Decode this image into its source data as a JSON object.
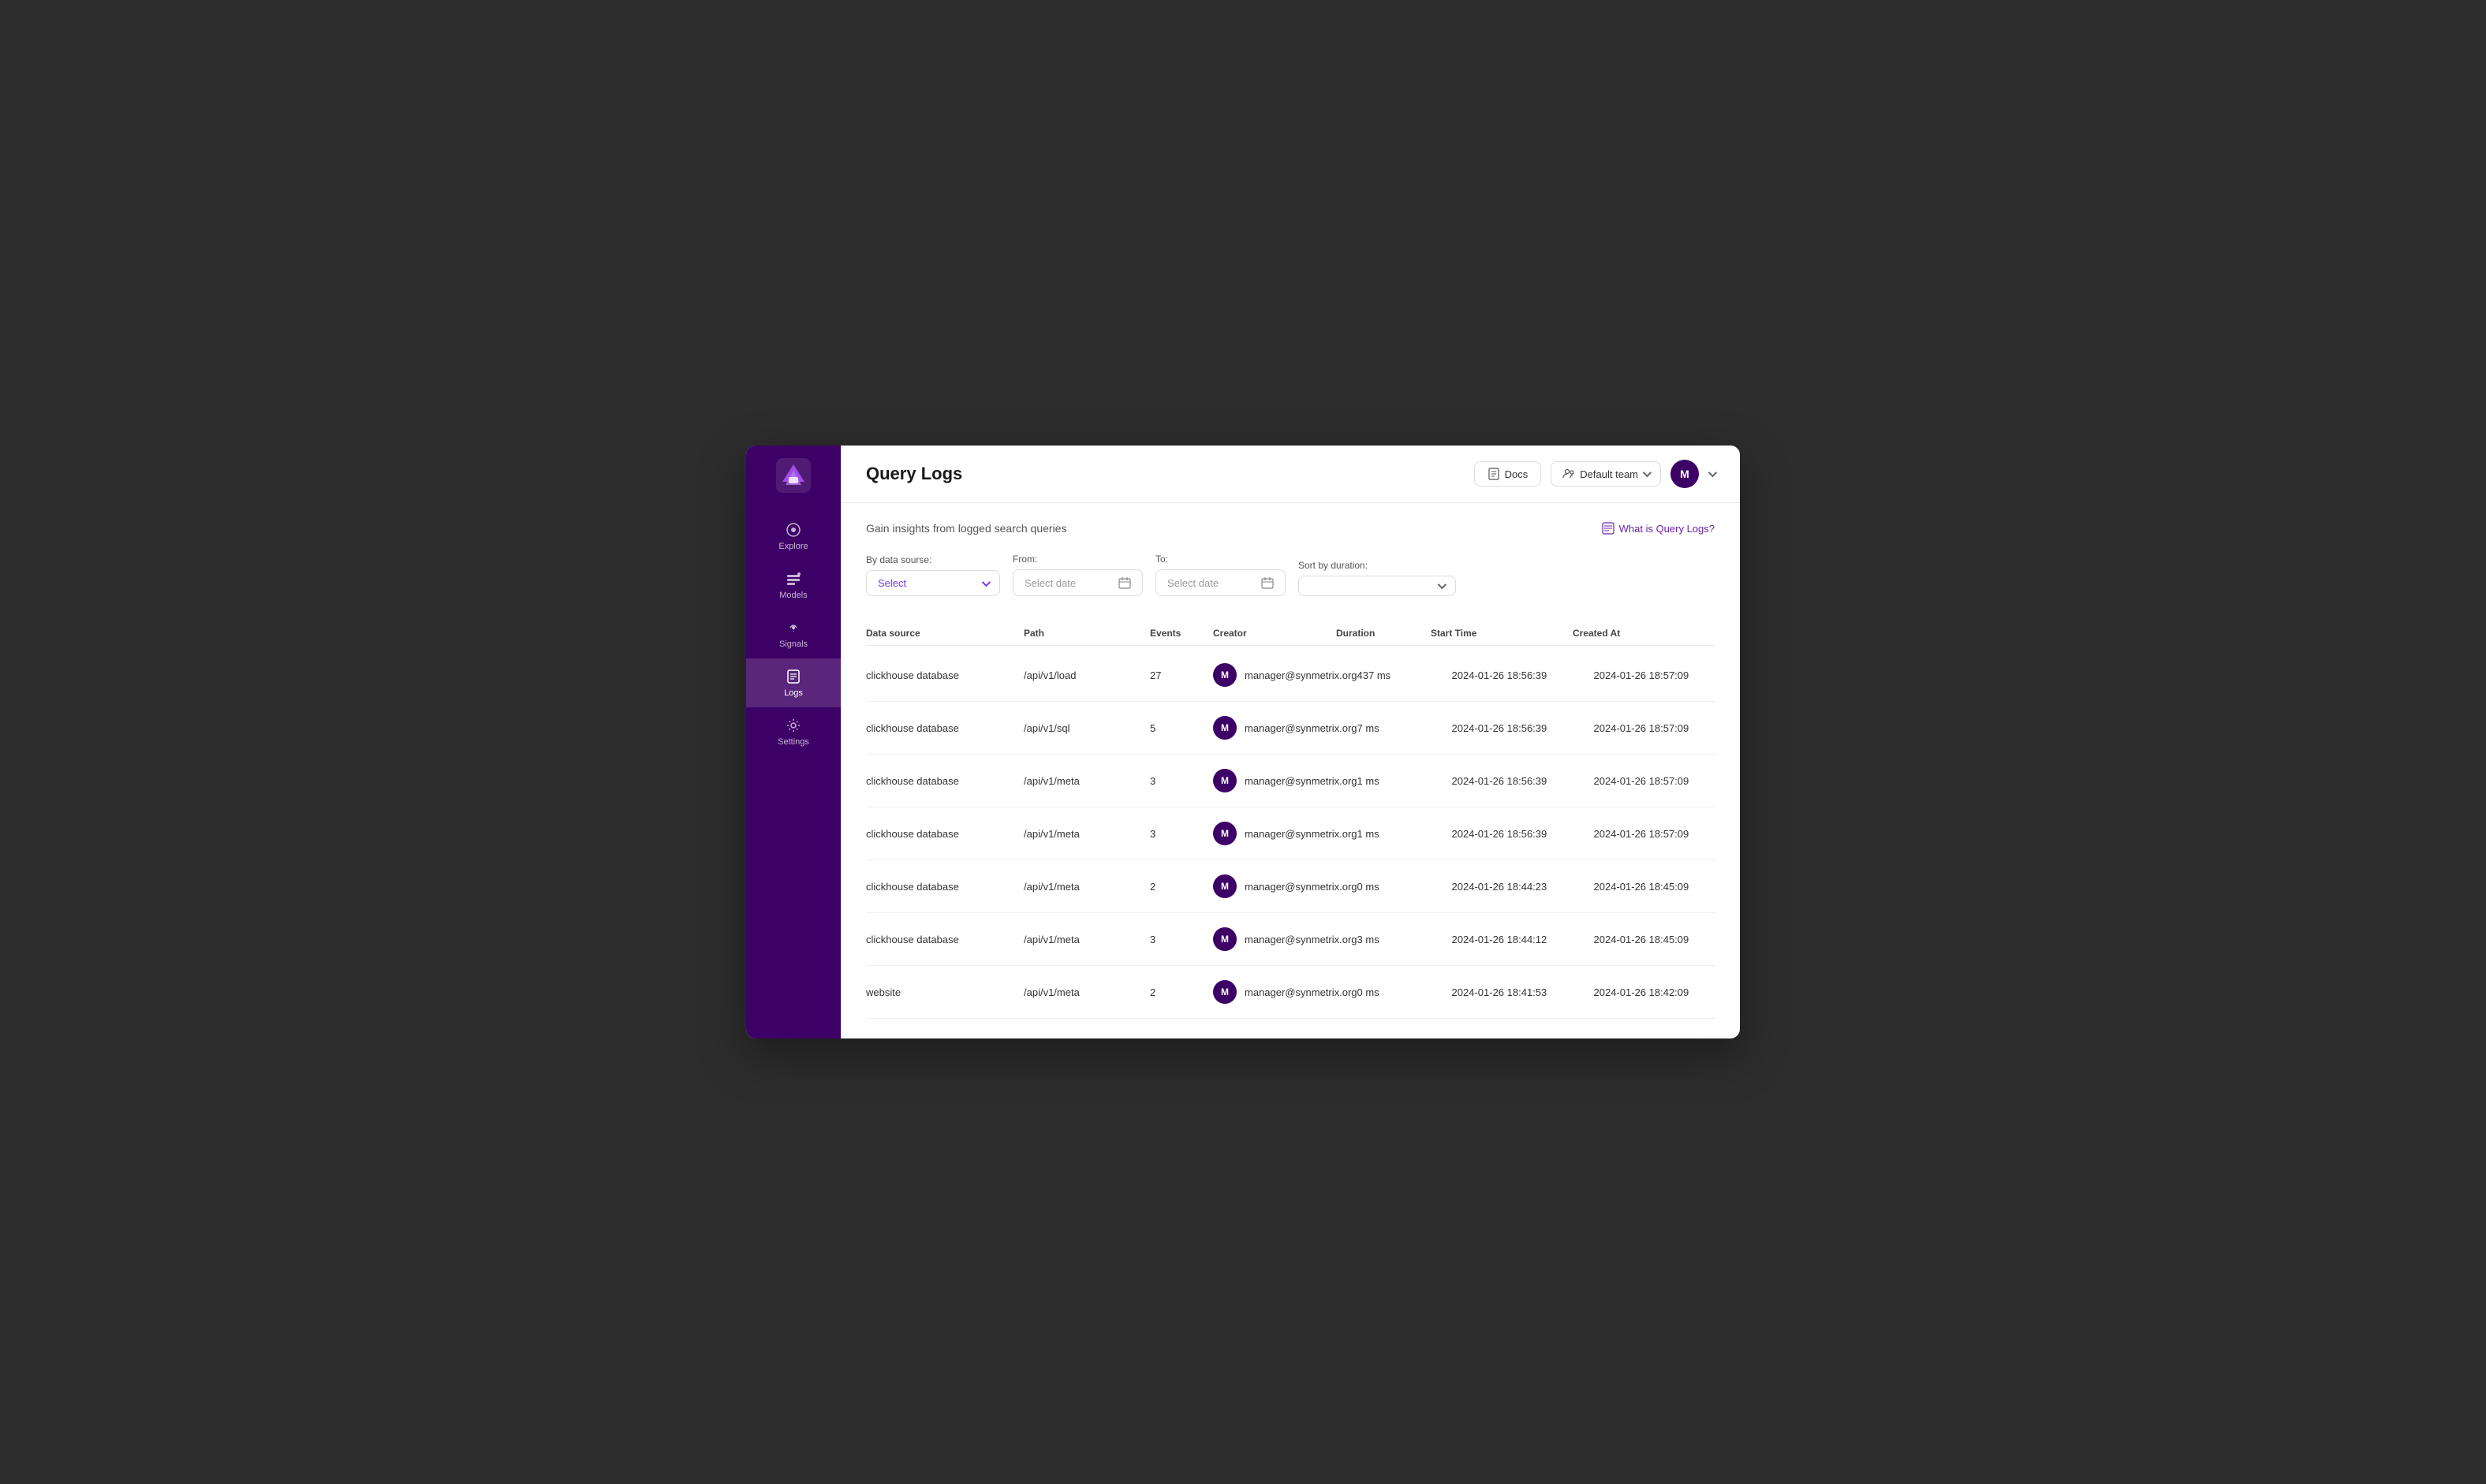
{
  "header": {
    "title": "Query Logs",
    "docs_label": "Docs",
    "team_label": "Default team",
    "user_initial": "M"
  },
  "content": {
    "subtitle": "Gain insights from logged search queries",
    "what_is_label": "What is Query Logs?",
    "filters": {
      "data_source_label": "By data sourse:",
      "data_source_placeholder": "Select",
      "from_label": "From:",
      "from_placeholder": "Select date",
      "to_label": "To:",
      "to_placeholder": "Select date",
      "sort_label": "Sort by duration:",
      "sort_placeholder": ""
    },
    "table": {
      "columns": [
        "Data source",
        "Path",
        "Events",
        "Creator",
        "Duration",
        "Start Time",
        "Created At"
      ],
      "rows": [
        {
          "data_source": "clickhouse database",
          "path": "/api/v1/load",
          "events": "27",
          "creator_initial": "M",
          "creator_email": "manager@synmetrix.org",
          "duration": "437 ms",
          "start_time": "2024-01-26 18:56:39",
          "created_at": "2024-01-26 18:57:09"
        },
        {
          "data_source": "clickhouse database",
          "path": "/api/v1/sql",
          "events": "5",
          "creator_initial": "M",
          "creator_email": "manager@synmetrix.org",
          "duration": "7 ms",
          "start_time": "2024-01-26 18:56:39",
          "created_at": "2024-01-26 18:57:09"
        },
        {
          "data_source": "clickhouse database",
          "path": "/api/v1/meta",
          "events": "3",
          "creator_initial": "M",
          "creator_email": "manager@synmetrix.org",
          "duration": "1 ms",
          "start_time": "2024-01-26 18:56:39",
          "created_at": "2024-01-26 18:57:09"
        },
        {
          "data_source": "clickhouse database",
          "path": "/api/v1/meta",
          "events": "3",
          "creator_initial": "M",
          "creator_email": "manager@synmetrix.org",
          "duration": "1 ms",
          "start_time": "2024-01-26 18:56:39",
          "created_at": "2024-01-26 18:57:09"
        },
        {
          "data_source": "clickhouse database",
          "path": "/api/v1/meta",
          "events": "2",
          "creator_initial": "M",
          "creator_email": "manager@synmetrix.org",
          "duration": "0 ms",
          "start_time": "2024-01-26 18:44:23",
          "created_at": "2024-01-26 18:45:09"
        },
        {
          "data_source": "clickhouse database",
          "path": "/api/v1/meta",
          "events": "3",
          "creator_initial": "M",
          "creator_email": "manager@synmetrix.org",
          "duration": "3 ms",
          "start_time": "2024-01-26 18:44:12",
          "created_at": "2024-01-26 18:45:09"
        },
        {
          "data_source": "website",
          "path": "/api/v1/meta",
          "events": "2",
          "creator_initial": "M",
          "creator_email": "manager@synmetrix.org",
          "duration": "0 ms",
          "start_time": "2024-01-26 18:41:53",
          "created_at": "2024-01-26 18:42:09"
        }
      ]
    }
  },
  "sidebar": {
    "items": [
      {
        "label": "Explore",
        "icon": "explore-icon"
      },
      {
        "label": "Models",
        "icon": "models-icon"
      },
      {
        "label": "Signals",
        "icon": "signals-icon"
      },
      {
        "label": "Logs",
        "icon": "logs-icon",
        "active": true
      },
      {
        "label": "Settings",
        "icon": "settings-icon"
      }
    ]
  },
  "colors": {
    "sidebar_bg": "#3d0066",
    "accent": "#7c3aed",
    "accent_dark": "#3d0066"
  }
}
